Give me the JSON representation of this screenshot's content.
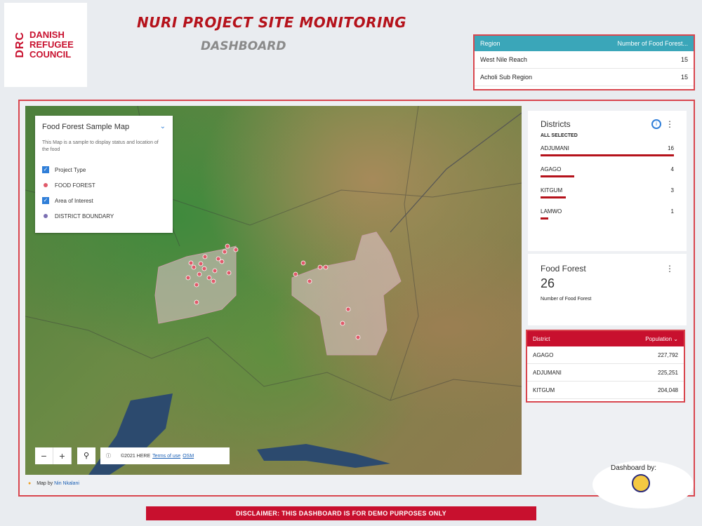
{
  "logo": {
    "mark": "DRC",
    "line1": "DANISH",
    "line2": "REFUGEE",
    "line3": "COUNCIL"
  },
  "header": {
    "title": "NURI PROJECT SITE MONITORING",
    "subtitle": "DASHBOARD"
  },
  "region_table": {
    "col1": "Region",
    "col2": "Number of Food Forest...",
    "rows": [
      {
        "region": "West Nile Reach",
        "count": "15"
      },
      {
        "region": "Acholi Sub Region",
        "count": "15"
      }
    ]
  },
  "map": {
    "legend": {
      "title": "Food Forest Sample Map",
      "description": "This Map is a sample to display status and location of the food",
      "layer1": "Project Type",
      "layer1_item": "FOOD FOREST",
      "layer2": "Area of Interest",
      "layer2_item": "DISTRICT BOUNDARY"
    },
    "attribution": "©2021 HERE",
    "terms": "Terms of use",
    "osm": "OSM",
    "map_by": "Map by",
    "author": "Nin Nkalani"
  },
  "districts": {
    "title": "Districts",
    "all_selected": "ALL SELECTED",
    "items": [
      {
        "name": "ADJUMANI",
        "value": "16",
        "fraction": 1.0
      },
      {
        "name": "AGAGO",
        "value": "4",
        "fraction": 0.25
      },
      {
        "name": "KITGUM",
        "value": "3",
        "fraction": 0.19
      },
      {
        "name": "LAMWO",
        "value": "1",
        "fraction": 0.06
      }
    ]
  },
  "food_forest": {
    "title": "Food Forest",
    "value": "26",
    "caption": "Number of Food Forest"
  },
  "population_table": {
    "col1": "District",
    "col2": "Population ⌄",
    "rows": [
      {
        "district": "AGAGO",
        "population": "227,792"
      },
      {
        "district": "ADJUMANI",
        "population": "225,251"
      },
      {
        "district": "KITGUM",
        "population": "204,048"
      }
    ]
  },
  "dashboard_by": "Dashboard by:",
  "disclaimer": "DISCLAIMER: THIS DASHBOARD IS FOR DEMO PURPOSES ONLY",
  "colors": {
    "brand_red": "#c8102e",
    "teal": "#3aa6b9",
    "accent_blue": "#2f7ed8"
  }
}
